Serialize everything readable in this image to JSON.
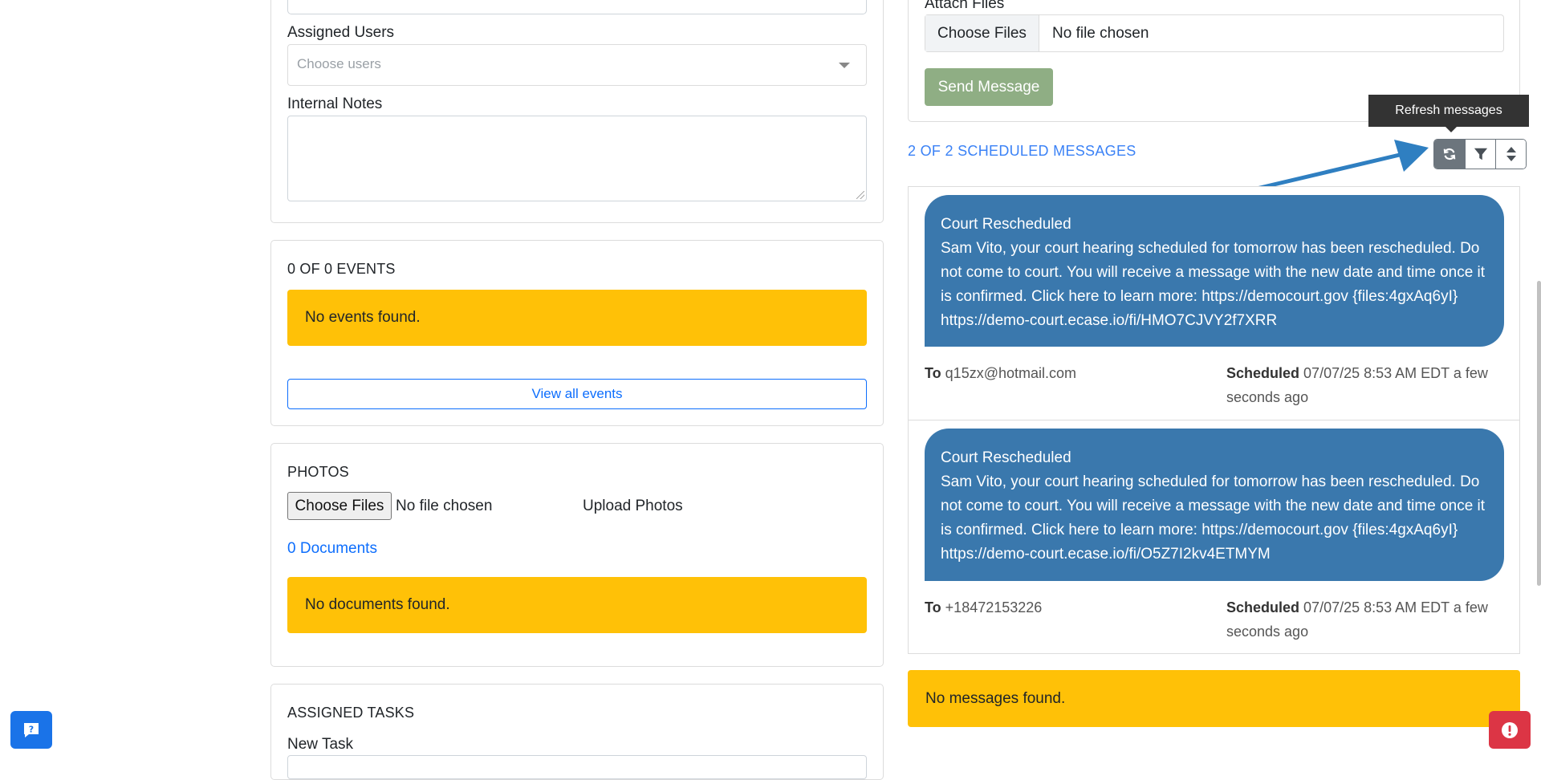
{
  "left": {
    "assigned_users_label": "Assigned Users",
    "assigned_users_placeholder": "Choose users",
    "internal_notes_label": "Internal Notes",
    "events": {
      "title": "0 OF 0 EVENTS",
      "empty": "No events found.",
      "view_all": "View all events"
    },
    "photos": {
      "title": "PHOTOS",
      "choose_files": "Choose Files",
      "no_file": "No file chosen",
      "upload": "Upload Photos",
      "documents_link": "0 Documents",
      "empty": "No documents found."
    },
    "tasks": {
      "title": "ASSIGNED TASKS",
      "new_task_label": "New Task"
    }
  },
  "right": {
    "attach_label": "Attach Files",
    "choose_files": "Choose Files",
    "no_file": "No file chosen",
    "send_button": "Send Message",
    "scheduled_header": "2 OF 2 SCHEDULED MESSAGES",
    "tooltip": "Refresh messages",
    "toolbar_icons": [
      "refresh-icon",
      "filter-icon",
      "sort-icon"
    ],
    "messages": [
      {
        "title": "Court Rescheduled",
        "body": "Sam Vito, your court hearing scheduled for tomorrow has been rescheduled. Do not come to court. You will receive a message with the new date and time once it is confirmed. Click here to learn more: https://democourt.gov {files:4gxAq6yI} https://demo-court.ecase.io/fi/HMO7CJVY2f7XRR",
        "to_label": "To",
        "to": "q15zx@hotmail.com",
        "scheduled_label": "Scheduled",
        "scheduled": "07/07/25 8:53 AM EDT a few seconds ago"
      },
      {
        "title": "Court Rescheduled",
        "body": "Sam Vito, your court hearing scheduled for tomorrow has been rescheduled. Do not come to court. You will receive a message with the new date and time once it is confirmed. Click here to learn more: https://democourt.gov {files:4gxAq6yI} https://demo-court.ecase.io/fi/O5Z7I2kv4ETMYM",
        "to_label": "To",
        "to": "+18472153226",
        "scheduled_label": "Scheduled",
        "scheduled": "07/07/25 8:53 AM EDT a few seconds ago"
      }
    ],
    "no_messages": "No messages found."
  },
  "colors": {
    "warning": "#ffc107",
    "bubble": "#3a78ad",
    "link": "#0d6efd",
    "send": "#8fae84",
    "annotation_arrow": "#2f7fc1"
  },
  "widgets": [
    "help-chat-icon",
    "alert-icon"
  ]
}
